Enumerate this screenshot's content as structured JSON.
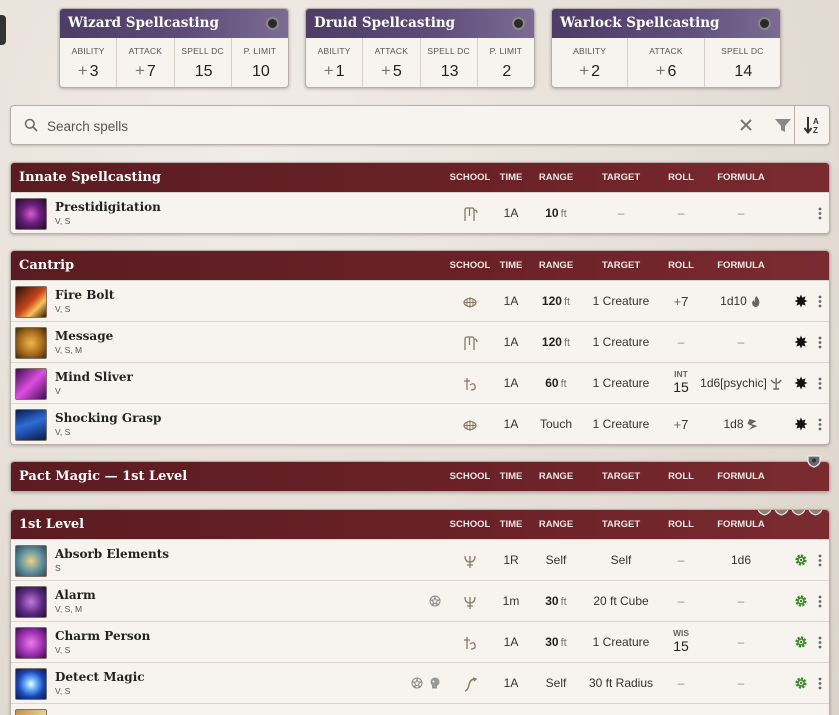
{
  "cards": [
    {
      "title": "Wizard Spellcasting",
      "stats": [
        {
          "label": "ABILITY",
          "sign": "+",
          "value": "3"
        },
        {
          "label": "ATTACK",
          "sign": "+",
          "value": "7"
        },
        {
          "label": "SPELL DC",
          "sign": "",
          "value": "15"
        },
        {
          "label": "P. LIMIT",
          "sign": "",
          "value": "10"
        }
      ]
    },
    {
      "title": "Druid Spellcasting",
      "stats": [
        {
          "label": "ABILITY",
          "sign": "+",
          "value": "1"
        },
        {
          "label": "ATTACK",
          "sign": "+",
          "value": "5"
        },
        {
          "label": "SPELL DC",
          "sign": "",
          "value": "13"
        },
        {
          "label": "P. LIMIT",
          "sign": "",
          "value": "2"
        }
      ]
    },
    {
      "title": "Warlock Spellcasting",
      "stats": [
        {
          "label": "ABILITY",
          "sign": "+",
          "value": "2"
        },
        {
          "label": "ATTACK",
          "sign": "+",
          "value": "6"
        },
        {
          "label": "SPELL DC",
          "sign": "",
          "value": "14"
        }
      ]
    }
  ],
  "search": {
    "placeholder": "Search spells"
  },
  "columns": {
    "school": "SCHOOL",
    "time": "TIME",
    "range": "RANGE",
    "target": "TARGET",
    "roll": "ROLL",
    "formula": "FORMULA"
  },
  "sections": [
    {
      "title": "Innate Spellcasting",
      "spells": [
        {
          "name": "Prestidigitation",
          "components": "V, S",
          "school_icon": "transmutation-icon",
          "time": "1A",
          "range": {
            "num": "10",
            "unit": "ft"
          },
          "target": "–",
          "roll": {
            "type": "dash",
            "text": "–"
          },
          "formula": {
            "text": "–",
            "dash": true
          }
        }
      ]
    },
    {
      "title": "Cantrip",
      "spells": [
        {
          "name": "Fire Bolt",
          "components": "V, S",
          "school_icon": "evocation-icon",
          "time": "1A",
          "range": {
            "num": "120",
            "unit": "ft"
          },
          "target": "1 Creature",
          "roll": {
            "type": "mod",
            "sign": "+",
            "value": "7"
          },
          "formula": {
            "text": "1d10",
            "dmg": "fire-damage-icon"
          },
          "action": "cast-icon"
        },
        {
          "name": "Message",
          "components": "V, S, M",
          "school_icon": "transmutation-icon",
          "time": "1A",
          "range": {
            "num": "120",
            "unit": "ft"
          },
          "target": "1 Creature",
          "roll": {
            "type": "dash",
            "text": "–"
          },
          "formula": {
            "text": "–",
            "dash": true
          },
          "action": "cast-icon"
        },
        {
          "name": "Mind Sliver",
          "components": "V",
          "school_icon": "enchantment-icon",
          "time": "1A",
          "range": {
            "num": "60",
            "unit": "ft"
          },
          "target": "1 Creature",
          "roll": {
            "type": "save",
            "ability": "INT",
            "dc": "15"
          },
          "formula": {
            "text": "1d6[psychic]",
            "dmg": "psychic-damage-icon"
          },
          "action": "cast-icon"
        },
        {
          "name": "Shocking Grasp",
          "components": "V, S",
          "school_icon": "evocation-icon",
          "time": "1A",
          "range": {
            "num": "Touch",
            "unit": ""
          },
          "target": "1 Creature",
          "roll": {
            "type": "mod",
            "sign": "+",
            "value": "7"
          },
          "formula": {
            "text": "1d8",
            "dmg": "lightning-damage-icon"
          },
          "action": "cast-icon"
        }
      ]
    },
    {
      "title": "Pact Magic — 1st Level",
      "spells": []
    },
    {
      "title": "1st Level",
      "spells": [
        {
          "name": "Absorb Elements",
          "components": "S",
          "school_icon": "abjuration-icon",
          "time": "1R",
          "range": {
            "num": "Self",
            "unit": ""
          },
          "target": "Self",
          "roll": {
            "type": "dash",
            "text": "–"
          },
          "formula": {
            "text": "1d6",
            "dash": false
          },
          "action": "prepared-gear-icon"
        },
        {
          "name": "Alarm",
          "components": "V, S, M",
          "school_icon": "abjuration-icon",
          "time": "1m",
          "range": {
            "num": "30",
            "unit": "ft"
          },
          "target": "20 ft Cube",
          "roll": {
            "type": "dash",
            "text": "–"
          },
          "formula": {
            "text": "–",
            "dash": true
          },
          "action": "prepared-gear-icon",
          "extras": [
            "ritual-icon"
          ]
        },
        {
          "name": "Charm Person",
          "components": "V, S",
          "school_icon": "enchantment-icon",
          "time": "1A",
          "range": {
            "num": "30",
            "unit": "ft"
          },
          "target": "1 Creature",
          "roll": {
            "type": "save",
            "ability": "WIS",
            "dc": "15"
          },
          "formula": {
            "text": "–",
            "dash": true
          },
          "action": "prepared-gear-icon"
        },
        {
          "name": "Detect Magic",
          "components": "V, S",
          "school_icon": "divination-icon",
          "time": "1A",
          "range": {
            "num": "Self",
            "unit": ""
          },
          "target": "30 ft Radius",
          "roll": {
            "type": "dash",
            "text": "–"
          },
          "formula": {
            "text": "–",
            "dash": true
          },
          "action": "prepared-gear-icon",
          "extras": [
            "ritual-icon",
            "concentration-icon"
          ]
        },
        {
          "name": "",
          "components": "",
          "school_icon": "",
          "time": "",
          "range": {
            "num": "",
            "unit": ""
          },
          "target": "",
          "roll": {
            "type": "none"
          },
          "formula": {
            "text": ""
          },
          "partial": true
        }
      ]
    }
  ],
  "colors": {
    "card_header": "#5e4b7a",
    "section_header": "#6b2228",
    "panel_bg": "#f7f4ef",
    "prepared_gear": "#3d8a2b"
  }
}
